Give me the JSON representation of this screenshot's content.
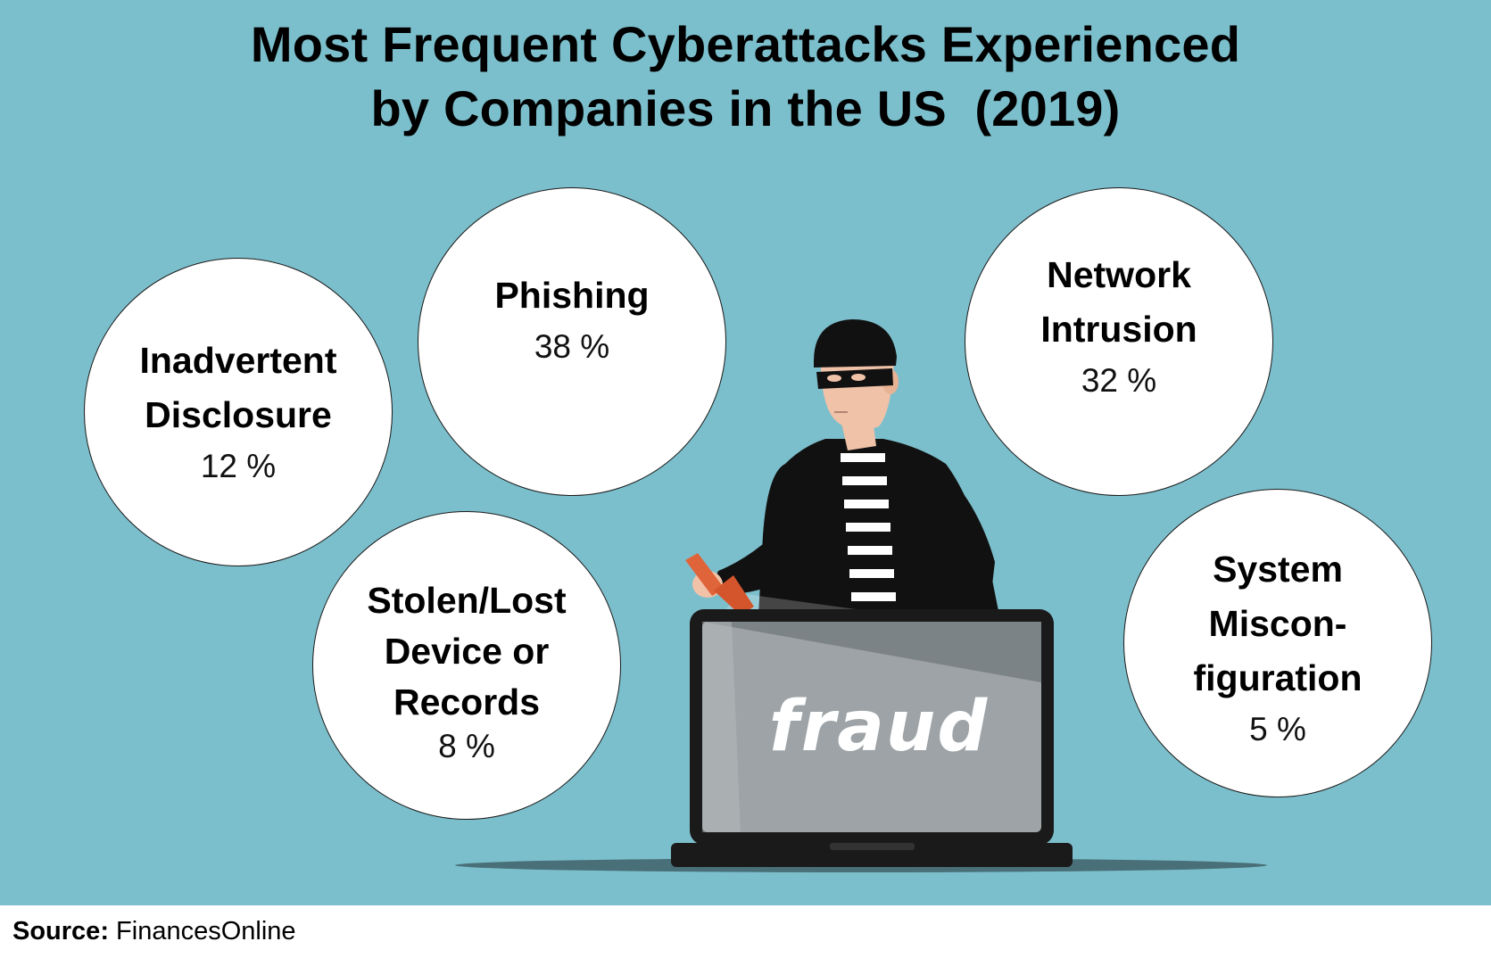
{
  "title": {
    "line1": "Most Frequent Cyberattacks Experienced",
    "line2": "by Companies in the US  (2019)"
  },
  "bubbles": [
    {
      "id": "inadvertent-disclosure",
      "label": "Inadvertent\nDisclosure",
      "value": "12 %"
    },
    {
      "id": "phishing",
      "label": "Phishing",
      "value": "38 %"
    },
    {
      "id": "network-intrusion",
      "label": "Network\nIntrusion",
      "value": "32 %"
    },
    {
      "id": "stolen-lost-device",
      "label": "Stolen/Lost\nDevice or\nRecords",
      "value": "8 %"
    },
    {
      "id": "system-misconfiguration",
      "label": "System\nMiscon-\nfiguration",
      "value": "5 %"
    }
  ],
  "illustration": {
    "screen_text": "fraud",
    "icons": [
      "burglar-icon",
      "laptop-icon",
      "flashlight-icon"
    ]
  },
  "footer": {
    "source_label": "Source:",
    "source_value": "FinancesOnline"
  },
  "colors": {
    "background": "#7cbfcc",
    "bubble": "#ffffff",
    "text": "#000000",
    "laptop_screen": "#9da3a6",
    "flashlight": "#e0643a"
  }
}
